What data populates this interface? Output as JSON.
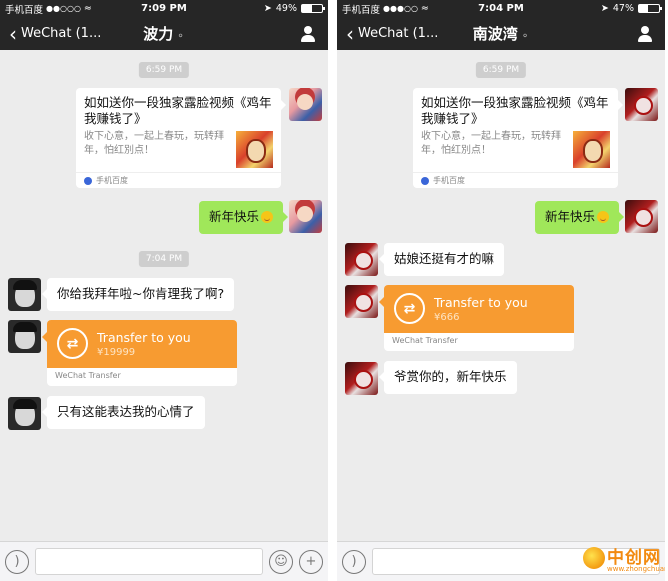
{
  "colors": {
    "bar": "#262626",
    "chat_bg": "#ececec",
    "out_bubble": "#a0e75a",
    "transfer": "#f79b31",
    "watermark": "#f28a10"
  },
  "left": {
    "status": {
      "carrier": "手机百度",
      "signal": "●●○○○",
      "time": "7:09 PM",
      "battery": "49%",
      "battery_level": 0.49
    },
    "nav": {
      "back": "WeChat (1...",
      "title": "波力"
    },
    "ts1": "6:59 PM",
    "card": {
      "title": "如如送你一段独家露脸视频《鸡年我赚钱了》",
      "desc": "收下心意，一起上春玩，玩转拜年，怕红別点！",
      "source": "手机百度"
    },
    "out_msg": "新年快乐",
    "ts2": "7:04 PM",
    "msg1": "你给我拜年啦~你肯理我了啊?",
    "transfer": {
      "label": "Transfer to you",
      "amount": "¥19999",
      "foot": "WeChat Transfer"
    },
    "msg2": "只有这能表达我的心情了"
  },
  "right": {
    "status": {
      "carrier": "手机百度",
      "signal": "●●●○○",
      "time": "7:04 PM",
      "battery": "47%",
      "battery_level": 0.47
    },
    "nav": {
      "back": "WeChat (1...",
      "title": "南波湾"
    },
    "ts1": "6:59 PM",
    "card": {
      "title": "如如送你一段独家露脸视频《鸡年我赚钱了》",
      "desc": "收下心意，一起上春玩，玩转拜年，怕红別点！",
      "source": "手机百度"
    },
    "out_msg": "新年快乐",
    "msg1": "姑娘还挺有才的嘛",
    "transfer": {
      "label": "Transfer to you",
      "amount": "¥666",
      "foot": "WeChat Transfer"
    },
    "msg2": "爷赏你的，新年快乐"
  },
  "watermark": {
    "text": "中创网",
    "url": "www.zhongchuang8.com"
  }
}
